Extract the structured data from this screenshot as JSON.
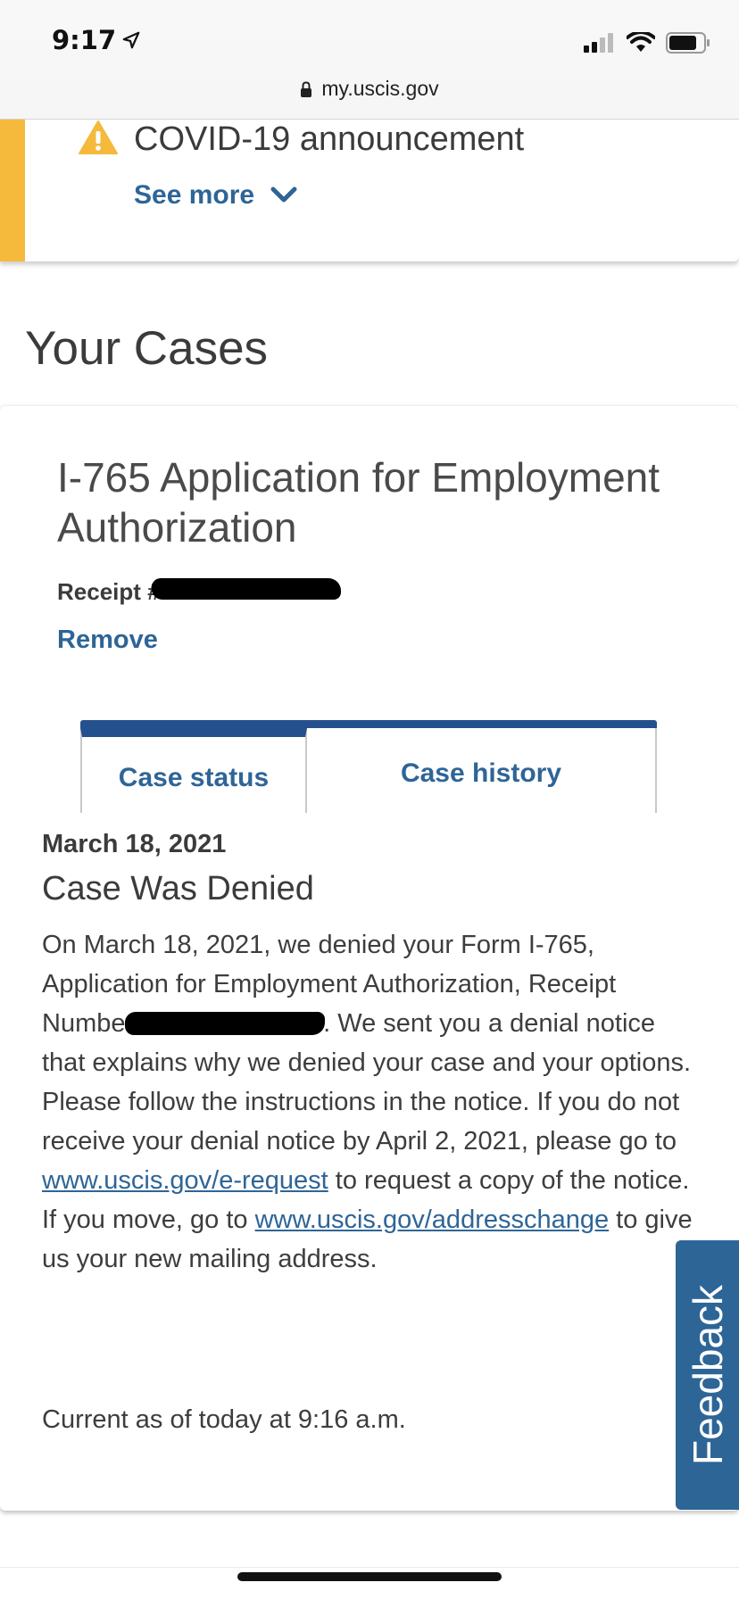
{
  "status_bar": {
    "time": "9:17",
    "url": "my.uscis.gov"
  },
  "alert": {
    "title": "COVID-19 announcement",
    "see_more": "See more",
    "accent_color": "#f5b93b"
  },
  "section_title": "Your Cases",
  "case": {
    "form_title": "I-765 Application for Employment Authorization",
    "receipt_label": "Receipt #",
    "remove_label": "Remove",
    "tabs": [
      {
        "label": "Case status",
        "active": true
      },
      {
        "label": "Case history",
        "active": false
      }
    ],
    "status": {
      "date": "March 18, 2021",
      "title": "Case Was Denied",
      "body_part1": "On March 18, 2021, we denied your Form I-765, Application for Employment Authorization, Receipt Number",
      "body_part2": ". We sent you a denial notice that explains why we denied your case and your options. Please follow the instructions in the notice. If you do not receive your denial notice by April 2, 2021, please go to ",
      "link1": "www.uscis.gov/e-request",
      "body_part3": " to request a copy of the notice. If you move, go to ",
      "link2": "www.uscis.gov/addresschange",
      "body_part4": " to give us your new mailing address.",
      "current_as_of": "Current as of today at 9:16 a.m."
    }
  },
  "feedback_label": "Feedback",
  "colors": {
    "link": "#2e6597",
    "tab_bar": "#25508e"
  }
}
